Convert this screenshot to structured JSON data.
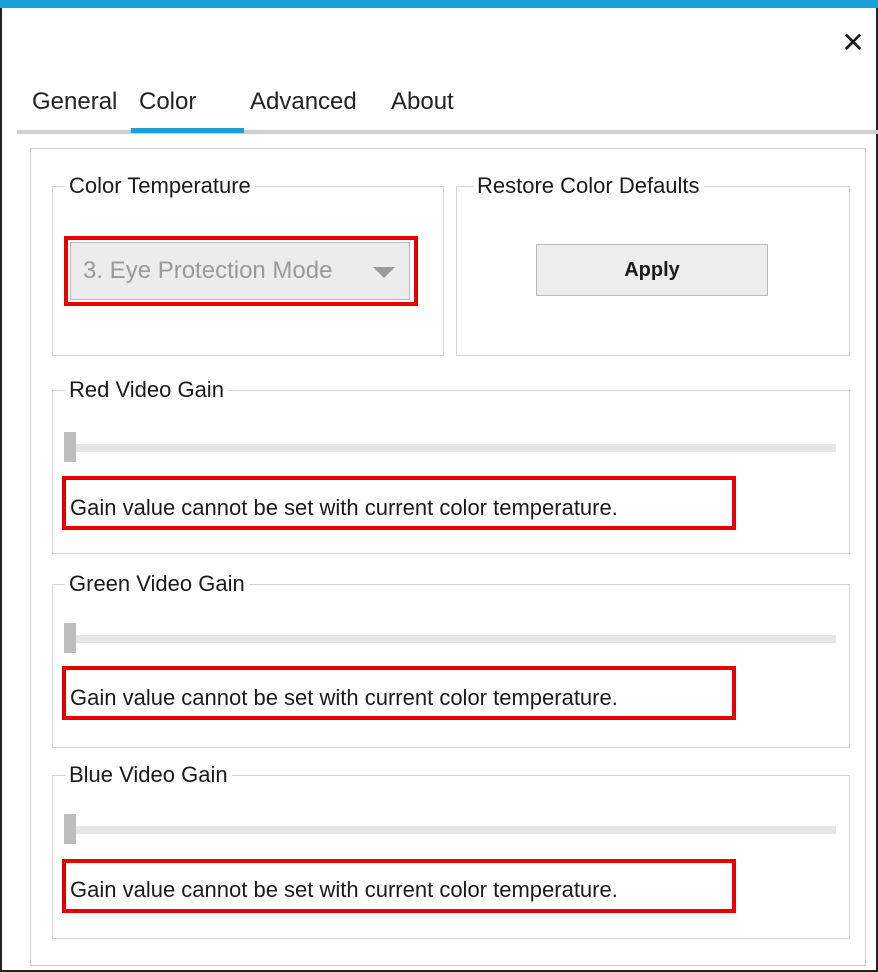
{
  "window": {
    "accent_color": "#1aa0d6",
    "close_icon": "close-icon"
  },
  "tabs": [
    {
      "label": "General",
      "active": false
    },
    {
      "label": "Color",
      "active": true
    },
    {
      "label": "Advanced",
      "active": false
    },
    {
      "label": "About",
      "active": false
    }
  ],
  "color_temperature": {
    "title": "Color Temperature",
    "selected": "3. Eye Protection Mode",
    "enabled": false
  },
  "restore_defaults": {
    "title": "Restore Color Defaults",
    "button_label": "Apply"
  },
  "gains": [
    {
      "title": "Red Video Gain",
      "value": 0,
      "message": "Gain value cannot be set with current color temperature."
    },
    {
      "title": "Green Video Gain",
      "value": 0,
      "message": "Gain value cannot be set with current color temperature."
    },
    {
      "title": "Blue Video Gain",
      "value": 0,
      "message": "Gain value cannot be set with current color temperature."
    }
  ],
  "highlight_color": "#e60000"
}
